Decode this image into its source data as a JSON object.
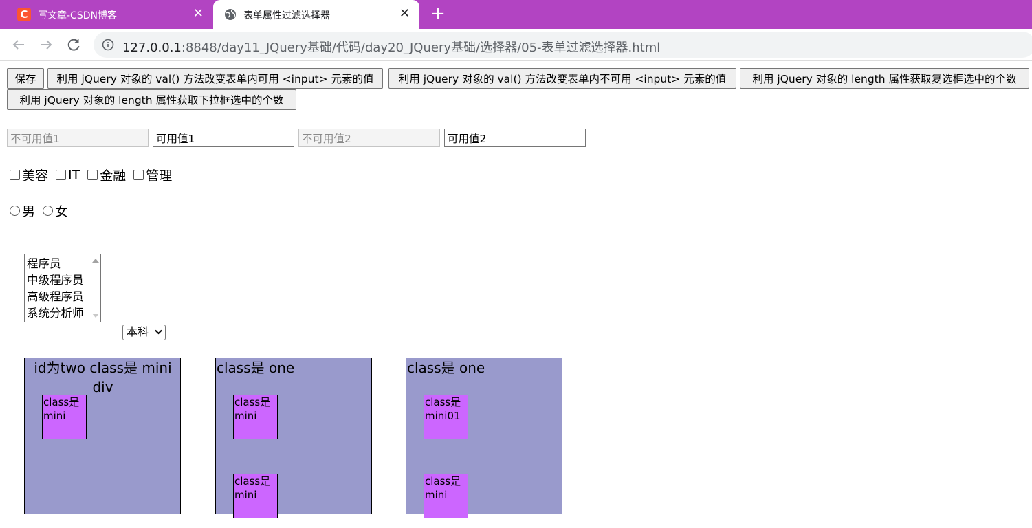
{
  "browser": {
    "tabs": [
      {
        "title": "写文章-CSDN博客",
        "favicon": "csdn-c-icon"
      },
      {
        "title": "表单属性过滤选择器",
        "favicon": "globe-icon"
      }
    ],
    "new_tab": "+",
    "close": "✕",
    "url_host": "127.0.0.1",
    "url_rest": ":8848/day11_JQuery基础/代码/day20_JQuery基础/选择器/05-表单过滤选择器.html"
  },
  "buttons": [
    "保存",
    "利用 jQuery 对象的 val() 方法改变表单内可用 <input> 元素的值",
    "利用 jQuery 对象的 val() 方法改变表单内不可用 <input> 元素的值",
    "利用 jQuery 对象的 length 属性获取复选框选中的个数",
    "利用 jQuery 对象的 length 属性获取下拉框选中的个数"
  ],
  "text_inputs": [
    {
      "value": "不可用值1",
      "disabled": true
    },
    {
      "value": "可用值1",
      "disabled": false
    },
    {
      "value": "不可用值2",
      "disabled": true
    },
    {
      "value": "可用值2",
      "disabled": false
    }
  ],
  "checkboxes": [
    "美容",
    "IT",
    "金融",
    "管理"
  ],
  "radios": [
    "男",
    "女"
  ],
  "listbox_options": [
    "程序员",
    "中级程序员",
    "高级程序员",
    "系统分析师"
  ],
  "dropdown": {
    "selected": "本科"
  },
  "boxes": [
    {
      "label": "id为two class是 mini div",
      "minis": [
        "class是mini"
      ]
    },
    {
      "label": "class是 one",
      "minis": [
        "class是mini",
        "class是mini"
      ]
    },
    {
      "label": "class是 one",
      "minis": [
        "class是mini01",
        "class是mini"
      ]
    }
  ],
  "colors": {
    "tabbar": "#b244c2",
    "bigbox": "#999acc",
    "mini": "#cc66ff"
  }
}
